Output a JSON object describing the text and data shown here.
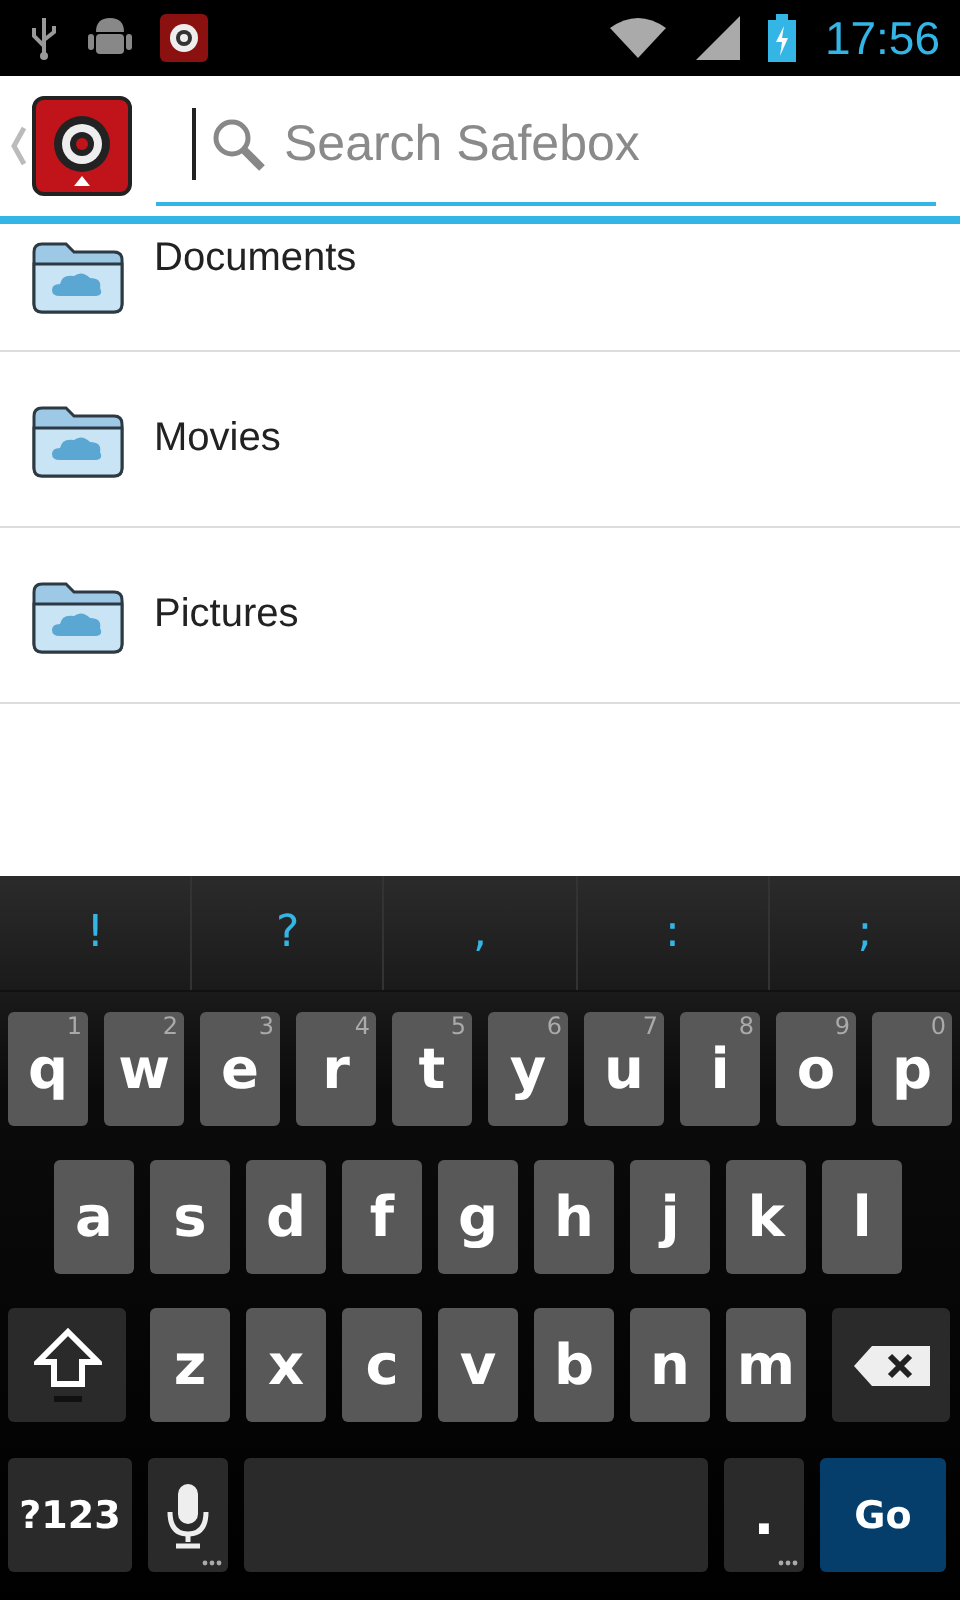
{
  "status_bar": {
    "time": "17:56"
  },
  "action_bar": {
    "search": {
      "placeholder": "Search Safebox"
    }
  },
  "folders": [
    {
      "name": "Documents"
    },
    {
      "name": "Movies"
    },
    {
      "name": "Pictures"
    }
  ],
  "keyboard": {
    "suggestions": [
      "!",
      "?",
      ",",
      ":",
      ";"
    ],
    "rows": [
      {
        "keys": [
          {
            "kind": "letter",
            "label": "q",
            "hint": "1"
          },
          {
            "kind": "letter",
            "label": "w",
            "hint": "2"
          },
          {
            "kind": "letter",
            "label": "e",
            "hint": "3"
          },
          {
            "kind": "letter",
            "label": "r",
            "hint": "4"
          },
          {
            "kind": "letter",
            "label": "t",
            "hint": "5"
          },
          {
            "kind": "letter",
            "label": "y",
            "hint": "6"
          },
          {
            "kind": "letter",
            "label": "u",
            "hint": "7"
          },
          {
            "kind": "letter",
            "label": "i",
            "hint": "8"
          },
          {
            "kind": "letter",
            "label": "o",
            "hint": "9"
          },
          {
            "kind": "letter",
            "label": "p",
            "hint": "0"
          }
        ]
      },
      {
        "keys": [
          {
            "kind": "letter",
            "label": "a"
          },
          {
            "kind": "letter",
            "label": "s"
          },
          {
            "kind": "letter",
            "label": "d"
          },
          {
            "kind": "letter",
            "label": "f"
          },
          {
            "kind": "letter",
            "label": "g"
          },
          {
            "kind": "letter",
            "label": "h"
          },
          {
            "kind": "letter",
            "label": "j"
          },
          {
            "kind": "letter",
            "label": "k"
          },
          {
            "kind": "letter",
            "label": "l"
          }
        ]
      },
      {
        "keys": [
          {
            "kind": "shift"
          },
          {
            "kind": "letter",
            "label": "z"
          },
          {
            "kind": "letter",
            "label": "x"
          },
          {
            "kind": "letter",
            "label": "c"
          },
          {
            "kind": "letter",
            "label": "v"
          },
          {
            "kind": "letter",
            "label": "b"
          },
          {
            "kind": "letter",
            "label": "n"
          },
          {
            "kind": "letter",
            "label": "m"
          },
          {
            "kind": "delete"
          }
        ]
      },
      {
        "keys": [
          {
            "kind": "symbols",
            "label": "?123"
          },
          {
            "kind": "mic",
            "more": true
          },
          {
            "kind": "space"
          },
          {
            "kind": "period",
            "label": ".",
            "more": true
          },
          {
            "kind": "action",
            "label": "Go"
          }
        ]
      }
    ]
  }
}
